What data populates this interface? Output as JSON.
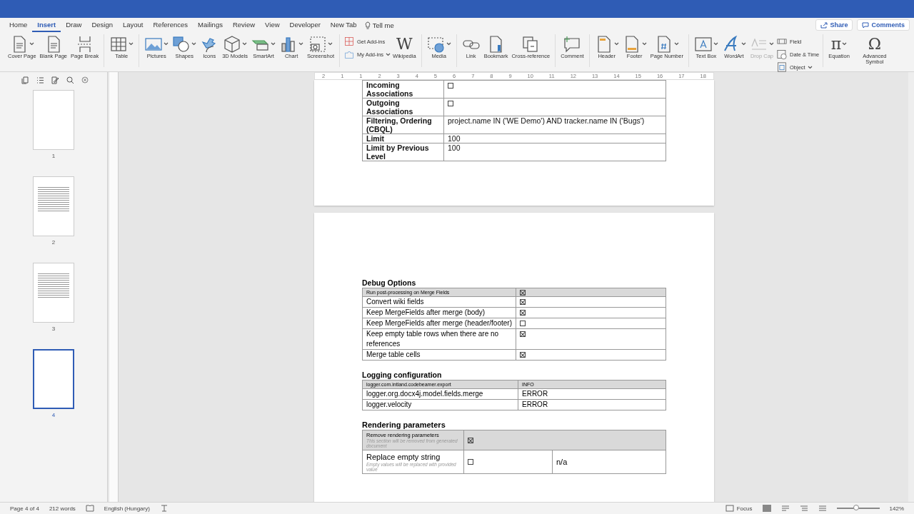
{
  "menu_tabs": [
    {
      "label": "Home",
      "selected": false
    },
    {
      "label": "Insert",
      "selected": true
    },
    {
      "label": "Draw",
      "selected": false
    },
    {
      "label": "Design",
      "selected": false
    },
    {
      "label": "Layout",
      "selected": false
    },
    {
      "label": "References",
      "selected": false
    },
    {
      "label": "Mailings",
      "selected": false
    },
    {
      "label": "Review",
      "selected": false
    },
    {
      "label": "View",
      "selected": false
    },
    {
      "label": "Developer",
      "selected": false
    },
    {
      "label": "New Tab",
      "selected": false
    }
  ],
  "tell_me": "Tell me",
  "share_button": "Share",
  "comments_button": "Comments",
  "ribbon_groups": [
    {
      "items": [
        {
          "label": "Cover Page",
          "dropdown": true
        },
        {
          "label": "Blank Page",
          "dropdown": false
        },
        {
          "label": "Page Break",
          "dropdown": false
        }
      ]
    },
    {
      "items": [
        {
          "label": "Table",
          "dropdown": true
        }
      ]
    },
    {
      "items": [
        {
          "label": "Pictures",
          "dropdown": true
        },
        {
          "label": "Shapes",
          "dropdown": true
        },
        {
          "label": "Icons",
          "dropdown": false
        },
        {
          "label": "3D Models",
          "dropdown": true
        },
        {
          "label": "SmartArt",
          "dropdown": true
        },
        {
          "label": "Chart",
          "dropdown": true
        },
        {
          "label": "Screenshot",
          "dropdown": true
        }
      ]
    },
    {
      "stack": [
        {
          "label": "Get Add-ins",
          "dropdown": false
        },
        {
          "label": "My Add-ins",
          "dropdown": true
        }
      ],
      "items": [
        {
          "label": "Wikipedia",
          "glyph": "W",
          "dropdown": false
        }
      ]
    },
    {
      "items": [
        {
          "label": "Media",
          "dropdown": true
        }
      ]
    },
    {
      "items": [
        {
          "label": "Link",
          "dropdown": false
        },
        {
          "label": "Bookmark",
          "dropdown": false
        },
        {
          "label": "Cross-reference",
          "dropdown": false
        }
      ]
    },
    {
      "items": [
        {
          "label": "Comment",
          "dropdown": false
        }
      ]
    },
    {
      "items": [
        {
          "label": "Header",
          "dropdown": true
        },
        {
          "label": "Footer",
          "dropdown": true
        },
        {
          "label": "Page Number",
          "dropdown": true
        }
      ]
    },
    {
      "items": [
        {
          "label": "Text Box",
          "dropdown": true
        },
        {
          "label": "WordArt",
          "dropdown": true
        },
        {
          "label": "Drop Cap",
          "dropdown": true,
          "disabled": true
        }
      ],
      "stack": [
        {
          "label": "Field",
          "dropdown": false
        },
        {
          "label": "Date & Time",
          "dropdown": false
        },
        {
          "label": "Object",
          "dropdown": true
        }
      ]
    },
    {
      "items": [
        {
          "label": "Equation",
          "glyph": "π",
          "dropdown": true
        },
        {
          "label": "Advanced Symbol",
          "glyph": "Ω",
          "dropdown": false
        }
      ]
    }
  ],
  "thumbnails": [
    {
      "label": "1",
      "selected": false,
      "kind": "blank"
    },
    {
      "label": "2",
      "selected": false,
      "kind": "text"
    },
    {
      "label": "3",
      "selected": false,
      "kind": "text"
    },
    {
      "label": "4",
      "selected": true,
      "kind": "blank"
    }
  ],
  "ruler_numbers": [
    "2",
    "1",
    "1",
    "2",
    "3",
    "4",
    "5",
    "6",
    "7",
    "8",
    "9",
    "10",
    "11",
    "12",
    "13",
    "14",
    "15",
    "16",
    "17",
    "18"
  ],
  "page_1_table": {
    "rows": [
      {
        "label": "Incoming Associations",
        "kind": "checkbox",
        "checked": false
      },
      {
        "label": "Outgoing Associations",
        "kind": "checkbox",
        "checked": false
      },
      {
        "label": "Filtering, Ordering (CBQL)",
        "kind": "text",
        "value": "project.name IN ('WE Demo') AND tracker.name IN ('Bugs')"
      },
      {
        "label": "Limit",
        "kind": "text",
        "value": "100"
      },
      {
        "label": "Limit by Previous Level",
        "kind": "text",
        "value": "100"
      }
    ]
  },
  "debug_options": {
    "title": "Debug Options",
    "header": {
      "label": "Run post-processing on Merge Fields",
      "checked": true
    },
    "rows": [
      {
        "label": "Convert wiki fields",
        "checked": true
      },
      {
        "label": "Keep MergeFields after merge (body)",
        "checked": true
      },
      {
        "label": "Keep MergeFields after merge (header/footer)",
        "checked": false
      },
      {
        "label": "Keep empty table rows when there are no references",
        "checked": true
      },
      {
        "label": "Merge table cells",
        "checked": true
      }
    ]
  },
  "logging_configuration": {
    "title": "Logging configuration",
    "header": {
      "logger": "logger.com.intland.codebeamer.export",
      "level": "INFO"
    },
    "rows": [
      {
        "logger": "logger.org.docx4j.model.fields.merge",
        "level": "ERROR"
      },
      {
        "logger": "logger.velocity",
        "level": "ERROR"
      }
    ]
  },
  "rendering_parameters": {
    "title": "Rendering parameters",
    "header": {
      "label": "Remove rendering parameters",
      "note": "This section will be removed from generated document",
      "checked": true
    },
    "rows": [
      {
        "label": "Replace empty string",
        "note": "Empty values will be replaced with provided value",
        "checked": false,
        "value": "n/a"
      }
    ]
  },
  "status_bar": {
    "page": "Page 4 of 4",
    "words": "212 words",
    "language": "English (Hungary)",
    "focus": "Focus",
    "zoom": "142%",
    "zoom_level": {
      "level": 0.45
    }
  }
}
